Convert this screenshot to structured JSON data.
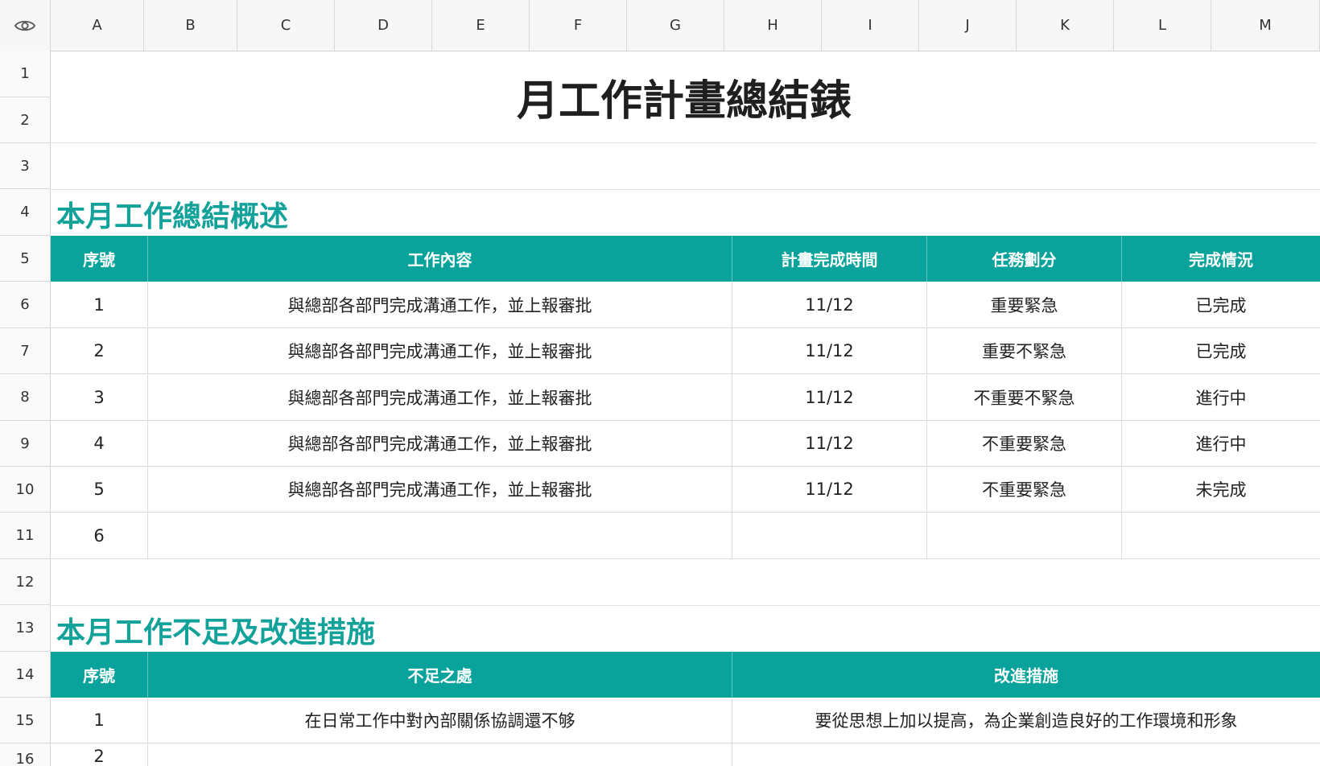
{
  "columns": [
    "A",
    "B",
    "C",
    "D",
    "E",
    "F",
    "G",
    "H",
    "I",
    "J",
    "K",
    "L",
    "M"
  ],
  "rows": [
    "1",
    "2",
    "3",
    "4",
    "5",
    "6",
    "7",
    "8",
    "9",
    "10",
    "11",
    "12",
    "13",
    "14",
    "15",
    "16"
  ],
  "title": "月工作計畫總結錶",
  "summary": {
    "heading": "本月工作總結概述",
    "headers": {
      "no": "序號",
      "content": "工作內容",
      "date": "計畫完成時間",
      "priority": "任務劃分",
      "status": "完成情況"
    },
    "rows": [
      {
        "no": "1",
        "content": "與總部各部門完成溝通工作，並上報審批",
        "date": "11/12",
        "priority": "重要緊急",
        "status": "已完成"
      },
      {
        "no": "2",
        "content": "與總部各部門完成溝通工作，並上報審批",
        "date": "11/12",
        "priority": "重要不緊急",
        "status": "已完成"
      },
      {
        "no": "3",
        "content": "與總部各部門完成溝通工作，並上報審批",
        "date": "11/12",
        "priority": "不重要不緊急",
        "status": "進行中"
      },
      {
        "no": "4",
        "content": "與總部各部門完成溝通工作，並上報審批",
        "date": "11/12",
        "priority": "不重要緊急",
        "status": "進行中"
      },
      {
        "no": "5",
        "content": "與總部各部門完成溝通工作，並上報審批",
        "date": "11/12",
        "priority": "不重要緊急",
        "status": "未完成"
      },
      {
        "no": "6",
        "content": "",
        "date": "",
        "priority": "",
        "status": ""
      }
    ]
  },
  "improvement": {
    "heading": "本月工作不足及改進措施",
    "headers": {
      "no": "序號",
      "shortfall": "不足之處",
      "measure": "改進措施"
    },
    "rows": [
      {
        "no": "1",
        "shortfall": "在日常工作中對內部關係協調還不够",
        "measure": "要從思想上加以提高，為企業創造良好的工作環境和形象"
      },
      {
        "no": "2",
        "shortfall": "",
        "measure": ""
      }
    ]
  },
  "colors": {
    "accent": "#0aa39b",
    "heading": "#12a29a"
  }
}
